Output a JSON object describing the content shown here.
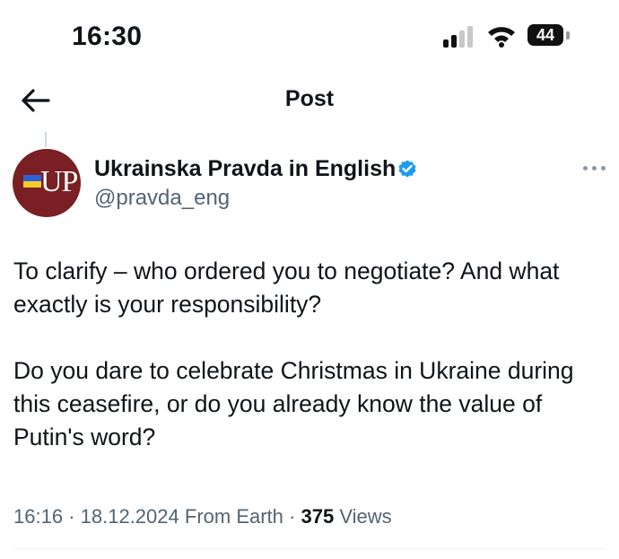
{
  "status_bar": {
    "time": "16:30",
    "battery_level": "44",
    "icons": [
      "signal-icon",
      "wifi-icon",
      "battery-icon"
    ]
  },
  "nav": {
    "back_icon": "arrow-left-icon",
    "title": "Post"
  },
  "author": {
    "avatar_monogram": "UP",
    "display_name": "Ukrainska Pravda in English",
    "handle": "@pravda_eng",
    "verified": true,
    "verified_color": "#1d9bf0"
  },
  "tweet": {
    "paragraphs": [
      "To clarify – who ordered you to negotiate? And what exactly is your responsibility?",
      "Do you dare to celebrate Christmas in Ukraine during this ceasefire, or do you already know the value of Putin's word?"
    ]
  },
  "meta": {
    "time": "16:16",
    "separator": "·",
    "date": "18.12.2024",
    "source": "From Earth",
    "views_count": "375",
    "views_label": "Views"
  },
  "colors": {
    "text_primary": "#0f1419",
    "text_secondary": "#536471",
    "avatar_bg": "#7a1f24"
  }
}
